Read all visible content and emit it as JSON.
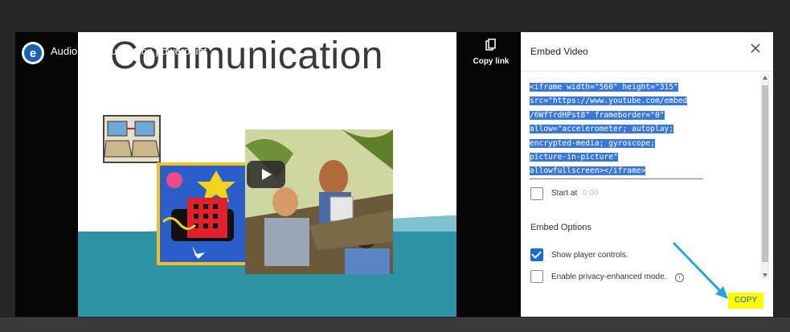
{
  "video": {
    "title": "Audio Communication powerpoint",
    "slide_heading": "Communication",
    "copy_link_label": "Copy link"
  },
  "dialog": {
    "title": "Embed Video",
    "embed_code_lines": [
      "<iframe width=\"560\" height=\"315\"",
      "src=\"https://www.youtube.com/embed",
      "/6WfTrdHPst8\" frameborder=\"0\"",
      "allow=\"accelerometer; autoplay;",
      "encrypted-media; gyroscope;",
      "picture-in-picture\"",
      "allowfullscreen></iframe>"
    ],
    "start_at_label": "Start at",
    "start_at_value": "0:00",
    "embed_options_title": "Embed Options",
    "options": [
      {
        "label": "Show player controls.",
        "checked": true
      },
      {
        "label": "Enable privacy-enhanced mode.",
        "checked": false
      }
    ],
    "copy_button": "COPY"
  },
  "colors": {
    "selection": "#3b78d6",
    "checkbox_checked": "#1d6ad1",
    "copy_highlight": "#fffc00",
    "annotation_arrow": "#29a3e0"
  }
}
